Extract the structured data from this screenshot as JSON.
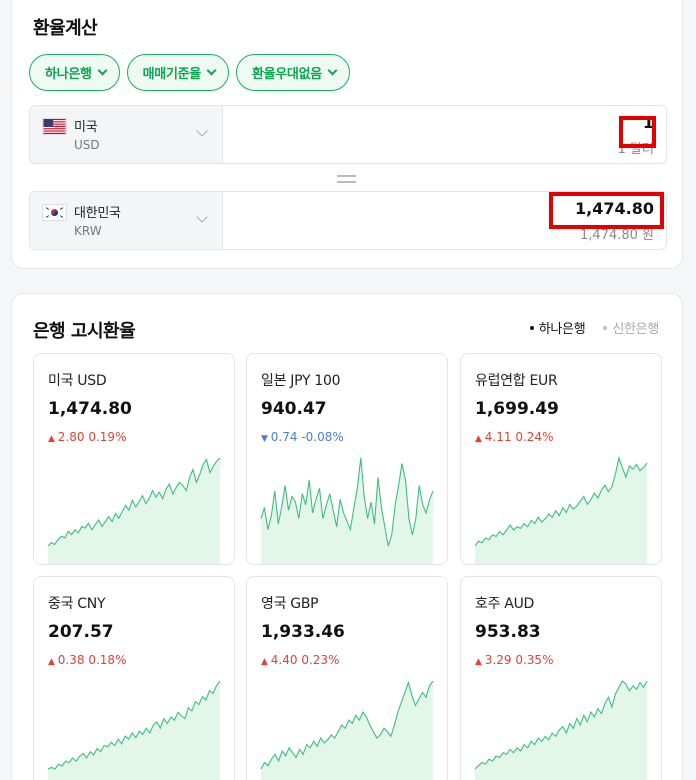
{
  "calculator": {
    "title": "환율계산",
    "chips": [
      "하나은행",
      "매매기준율",
      "환율우대없음"
    ],
    "from": {
      "country": "미국",
      "code": "USD",
      "amount": "1",
      "amount_sub": "1 달러"
    },
    "to": {
      "country": "대한민국",
      "code": "KRW",
      "amount": "1,474.80",
      "amount_sub": "1,474.80 원"
    }
  },
  "rates": {
    "title": "은행 고시환율",
    "banks": [
      {
        "label": "하나은행",
        "active": true
      },
      {
        "label": "신한은행",
        "active": false
      }
    ],
    "items": [
      {
        "name": "미국 USD",
        "value": "1,474.80",
        "change": "2.80",
        "pct": "0.19%",
        "dir": "up",
        "trend": [
          2,
          4,
          3,
          6,
          8,
          7,
          11,
          9,
          12,
          10,
          14,
          13,
          16,
          12,
          15,
          18,
          14,
          17,
          20,
          17,
          22,
          19,
          23,
          27,
          24,
          30,
          26,
          29,
          33,
          28,
          31,
          36,
          32,
          35,
          31,
          37,
          40,
          34,
          38,
          41,
          39,
          36,
          44,
          49,
          41,
          46,
          52,
          55,
          47,
          51,
          54,
          56
        ]
      },
      {
        "name": "일본 JPY 100",
        "value": "940.47",
        "change": "0.74",
        "pct": "-0.08%",
        "dir": "down",
        "trend": [
          30,
          34,
          26,
          31,
          40,
          28,
          34,
          42,
          33,
          38,
          36,
          30,
          39,
          35,
          44,
          32,
          37,
          41,
          30,
          35,
          39,
          33,
          27,
          37,
          32,
          29,
          26,
          34,
          41,
          52,
          38,
          30,
          36,
          28,
          45,
          34,
          27,
          20,
          24,
          35,
          42,
          50,
          44,
          30,
          24,
          30,
          42,
          35,
          32,
          37,
          40
        ]
      },
      {
        "name": "유럽연합 EUR",
        "value": "1,699.49",
        "change": "4.11",
        "pct": "0.24%",
        "dir": "up",
        "trend": [
          2,
          5,
          4,
          7,
          6,
          9,
          8,
          11,
          9,
          12,
          15,
          12,
          14,
          13,
          16,
          14,
          18,
          16,
          20,
          17,
          19,
          22,
          20,
          24,
          21,
          26,
          23,
          28,
          25,
          27,
          30,
          33,
          28,
          31,
          35,
          32,
          37,
          40,
          36,
          39,
          47,
          57,
          51,
          45,
          52,
          50,
          53,
          49,
          51,
          54
        ]
      },
      {
        "name": "중국 CNY",
        "value": "207.57",
        "change": "0.38",
        "pct": "0.18%",
        "dir": "up",
        "trend": [
          2,
          3,
          2,
          5,
          4,
          7,
          6,
          9,
          7,
          10,
          12,
          9,
          13,
          11,
          15,
          13,
          17,
          16,
          19,
          17,
          21,
          18,
          23,
          21,
          25,
          22,
          26,
          24,
          28,
          25,
          30,
          32,
          28,
          34,
          31,
          35,
          33,
          38,
          36,
          34,
          41,
          39,
          45,
          43,
          48,
          46,
          52,
          50,
          55,
          58
        ]
      },
      {
        "name": "영국 GBP",
        "value": "1,933.46",
        "change": "4.40",
        "pct": "0.23%",
        "dir": "up",
        "trend": [
          3,
          7,
          5,
          9,
          12,
          8,
          14,
          11,
          16,
          13,
          10,
          15,
          12,
          18,
          16,
          20,
          17,
          22,
          19,
          21,
          24,
          22,
          26,
          30,
          28,
          33,
          31,
          36,
          33,
          38,
          35,
          30,
          26,
          22,
          24,
          28,
          26,
          23,
          30,
          38,
          44,
          50,
          56,
          48,
          42,
          46,
          50,
          47,
          54,
          57
        ]
      },
      {
        "name": "호주 AUD",
        "value": "953.83",
        "change": "3.29",
        "pct": "0.35%",
        "dir": "up",
        "trend": [
          2,
          4,
          6,
          5,
          8,
          7,
          10,
          9,
          12,
          11,
          14,
          12,
          15,
          13,
          17,
          15,
          19,
          17,
          21,
          19,
          22,
          20,
          24,
          22,
          26,
          28,
          24,
          30,
          27,
          33,
          29,
          35,
          31,
          37,
          34,
          39,
          36,
          42,
          46,
          40,
          48,
          52,
          56,
          54,
          50,
          53,
          51,
          55,
          52,
          56
        ]
      }
    ]
  },
  "colors": {
    "accent": "#0ba44f",
    "up": "#e0423c",
    "down": "#4a7fd6",
    "chart_line": "#3cc07a",
    "chart_fill": "#e3f6ea",
    "highlight_box": "#e50000"
  },
  "icons": {
    "chip_chevron": "chevron-down-icon",
    "select_chevron": "chevron-down-icon",
    "up_arrow": "triangle-up-icon",
    "down_arrow": "triangle-down-icon"
  }
}
